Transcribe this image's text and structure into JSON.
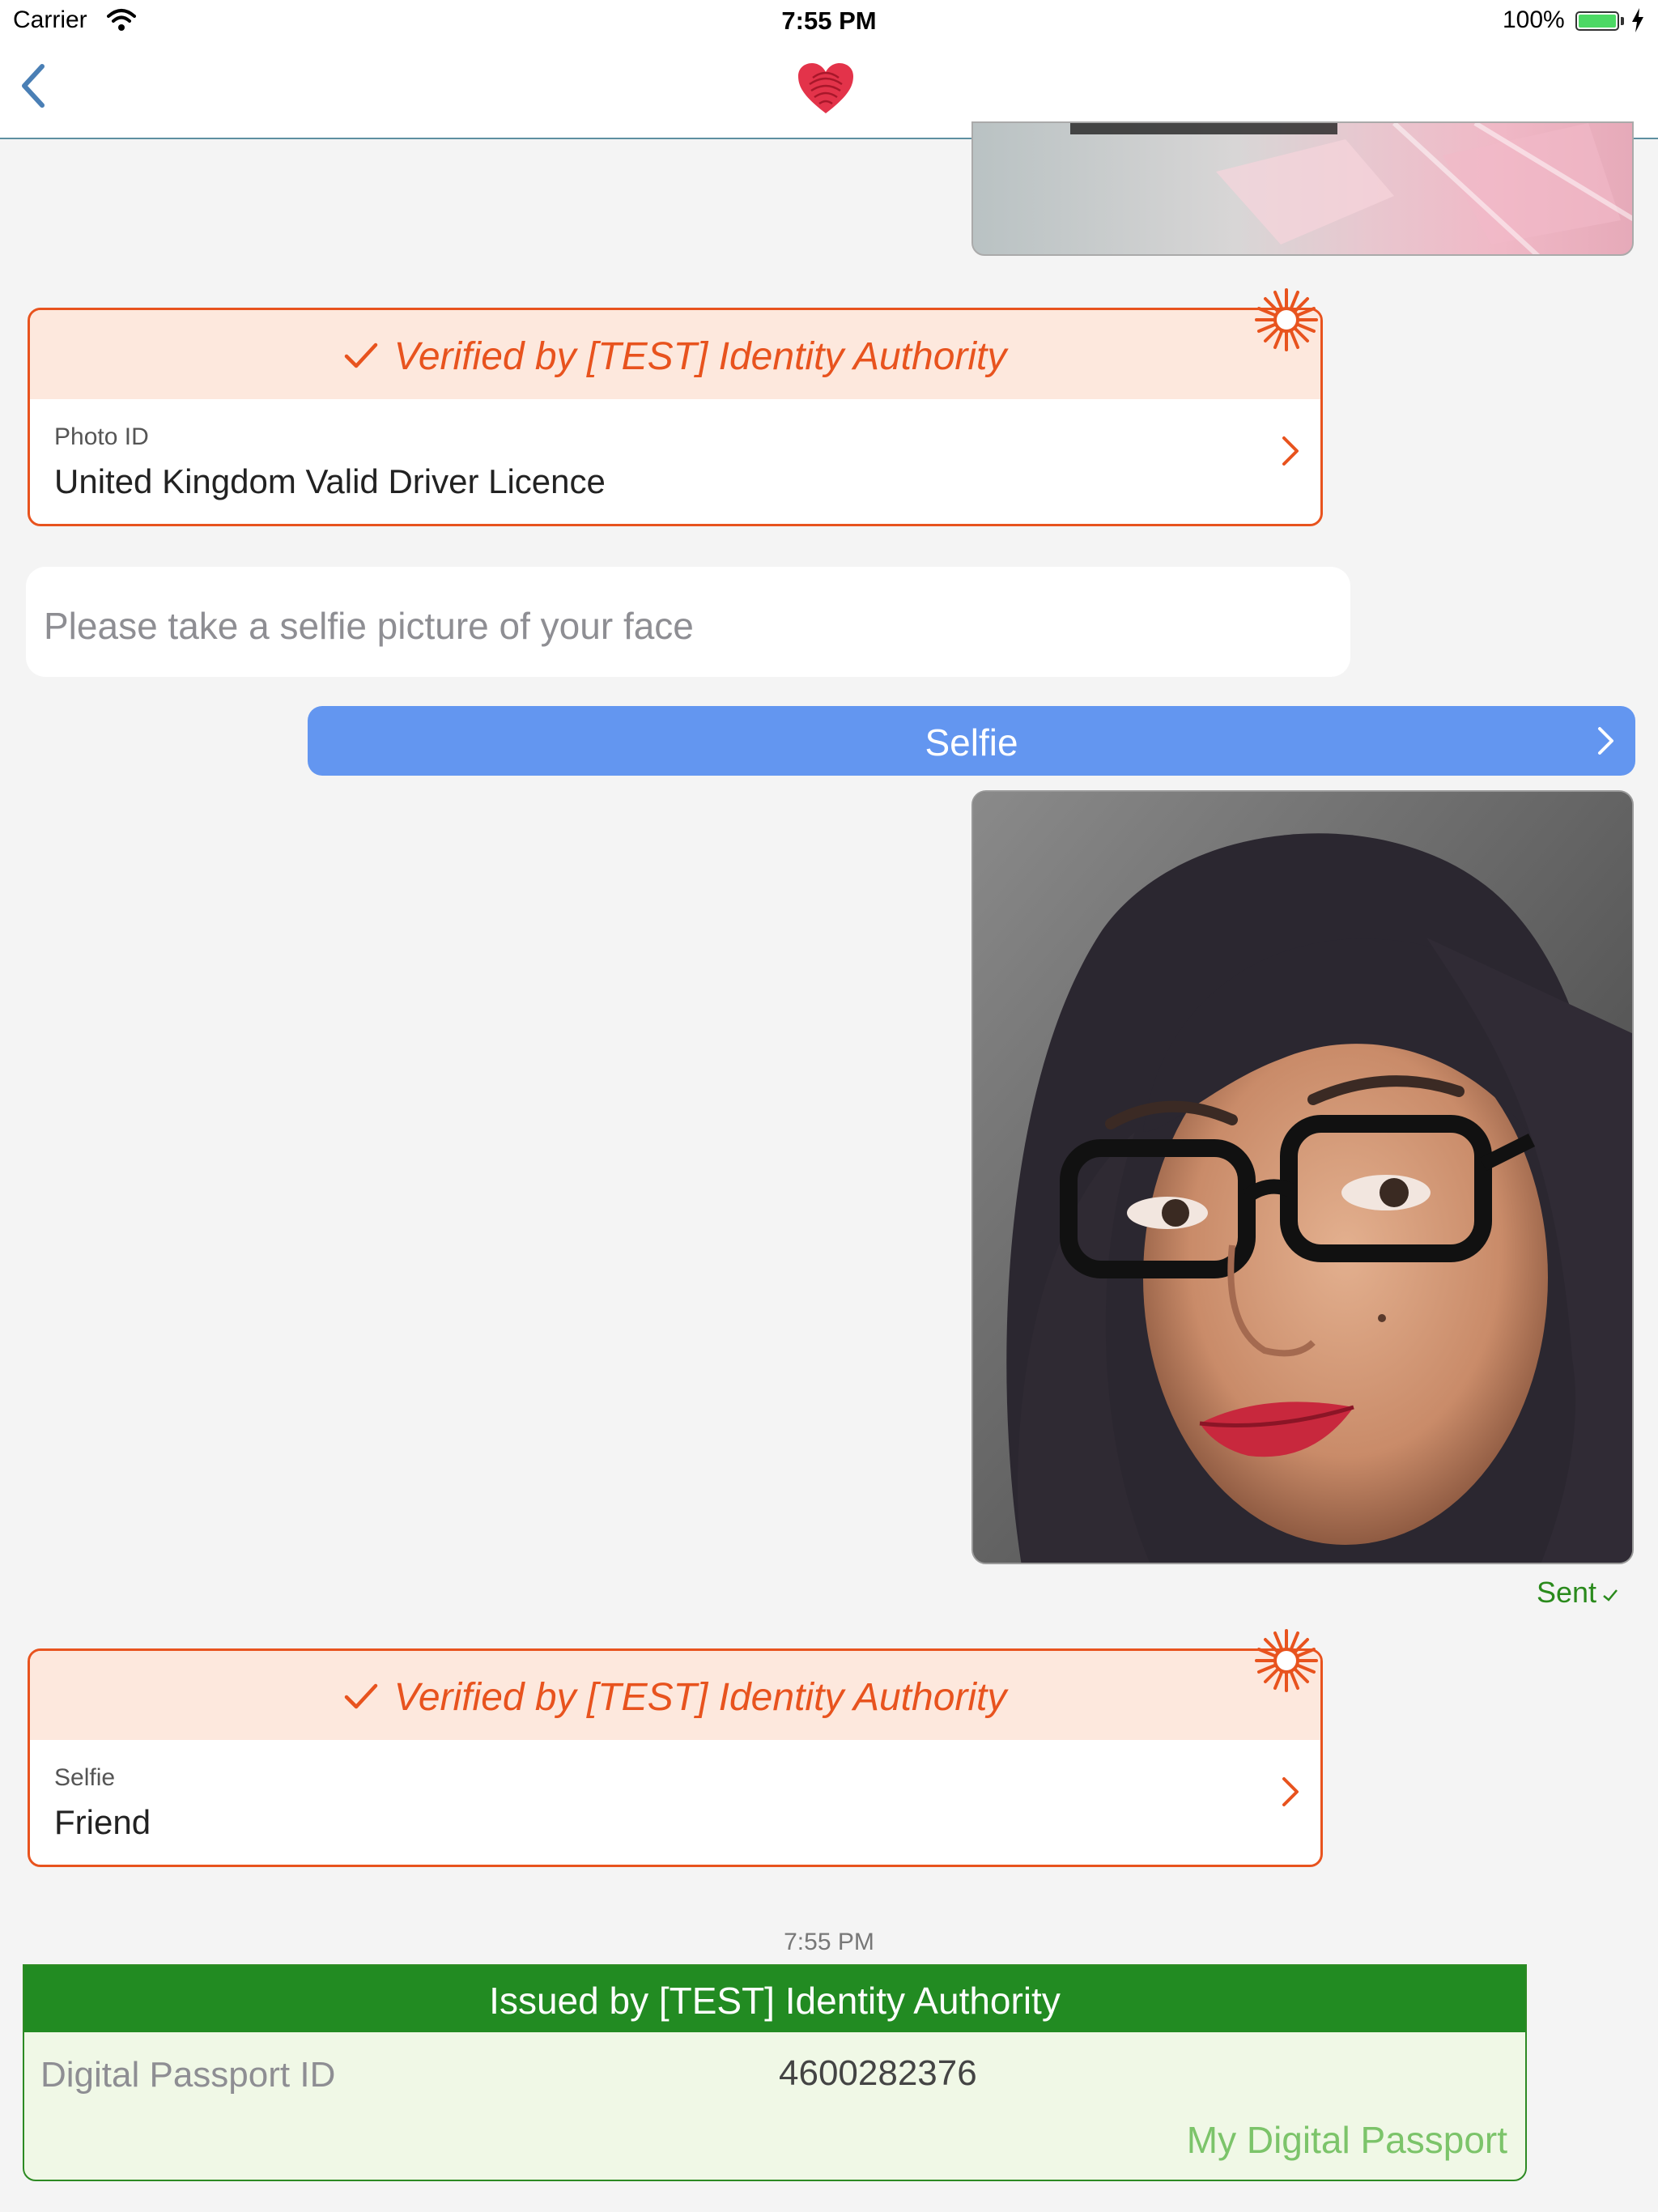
{
  "status_bar": {
    "carrier": "Carrier",
    "time": "7:55 PM",
    "battery": "100%"
  },
  "nav": {
    "back_icon": "chevron-left-icon",
    "logo_icon": "heart-fingerprint-logo"
  },
  "messages": {
    "verified_cards": [
      {
        "title": "Verified by [TEST] Identity Authority",
        "label": "Photo ID",
        "value": "United Kingdom Valid Driver Licence"
      },
      {
        "title": "Verified by [TEST] Identity Authority",
        "label": "Selfie",
        "value": "Friend"
      }
    ],
    "prompt": "Please take a selfie picture of your face",
    "selfie_button": "Selfie",
    "sent_status": "Sent",
    "timestamp": "7:55 PM",
    "issued_card": {
      "title": "Issued by [TEST] Identity Authority",
      "label": "Digital Passport ID",
      "value": "4600282376",
      "footer": "My Digital Passport"
    }
  },
  "colors": {
    "accent_orange": "#e8531e",
    "button_blue": "#6396f0",
    "issued_green": "#228b22",
    "nav_back_blue": "#4a7fb5"
  }
}
